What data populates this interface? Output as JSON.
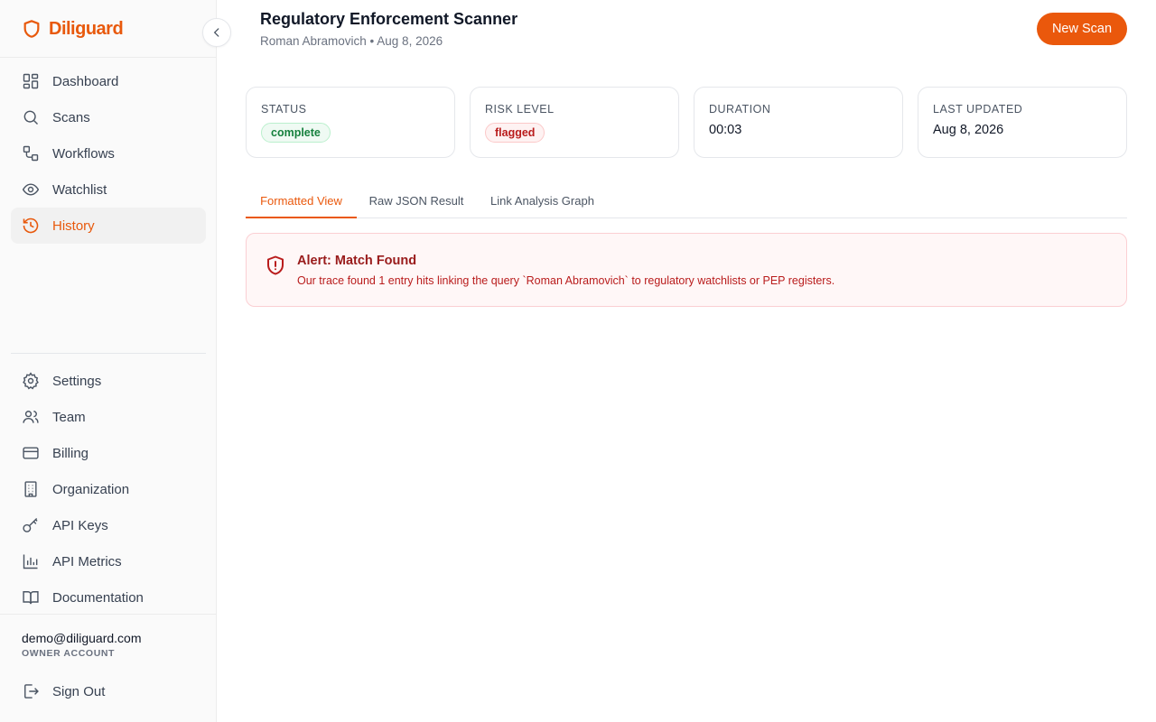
{
  "brand": {
    "name": "Diliguard",
    "accent": "#e8590c"
  },
  "sidebar": {
    "primary": [
      {
        "label": "Dashboard",
        "icon": "dashboard-icon",
        "active": false
      },
      {
        "label": "Scans",
        "icon": "search-icon",
        "active": false
      },
      {
        "label": "Workflows",
        "icon": "workflow-icon",
        "active": false
      },
      {
        "label": "Watchlist",
        "icon": "eye-icon",
        "active": false
      },
      {
        "label": "History",
        "icon": "history-icon",
        "active": true
      }
    ],
    "secondary": [
      {
        "label": "Settings",
        "icon": "gear-icon"
      },
      {
        "label": "Team",
        "icon": "users-icon"
      },
      {
        "label": "Billing",
        "icon": "credit-card-icon"
      },
      {
        "label": "Organization",
        "icon": "building-icon"
      },
      {
        "label": "API Keys",
        "icon": "key-icon"
      },
      {
        "label": "API Metrics",
        "icon": "bar-chart-icon"
      },
      {
        "label": "Documentation",
        "icon": "book-icon"
      }
    ],
    "account": {
      "email": "demo@diliguard.com",
      "role": "OWNER ACCOUNT"
    },
    "signout_label": "Sign Out"
  },
  "header": {
    "title": "Regulatory Enforcement Scanner",
    "subtitle": "Roman Abramovich • Aug 8, 2026",
    "new_scan_label": "New Scan"
  },
  "cards": {
    "status": {
      "label": "STATUS",
      "value": "complete",
      "color": "#15803d"
    },
    "risk": {
      "label": "RISK LEVEL",
      "value": "flagged",
      "color": "#b91c1c"
    },
    "duration": {
      "label": "DURATION",
      "value": "00:03"
    },
    "updated": {
      "label": "LAST UPDATED",
      "value": "Aug 8, 2026"
    }
  },
  "tabs": [
    {
      "label": "Formatted View",
      "active": true
    },
    {
      "label": "Raw JSON Result",
      "active": false
    },
    {
      "label": "Link Analysis Graph",
      "active": false
    }
  ],
  "alert": {
    "title": "Alert: Match Found",
    "text": "Our trace found 1 entry hits linking the query `Roman Abramovich` to regulatory watchlists or PEP registers.",
    "color": "#991b1b"
  }
}
